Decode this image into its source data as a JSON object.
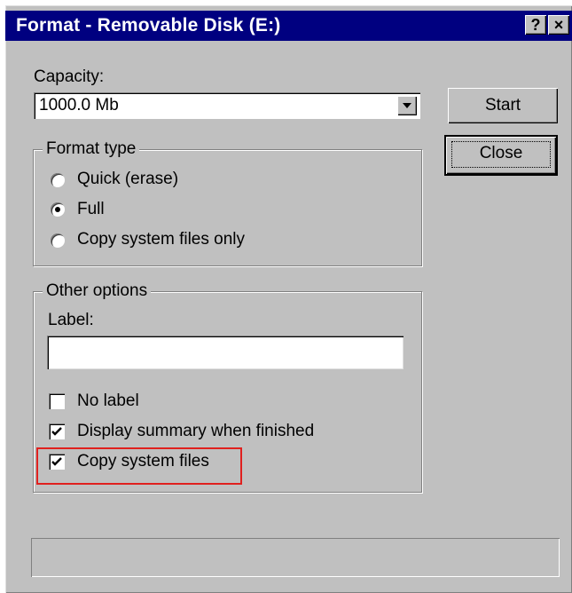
{
  "window": {
    "title": "Format - Removable Disk (E:)",
    "help_label": "?",
    "close_label": "×"
  },
  "capacity": {
    "label": "Capacity:",
    "value": "1000.0 Mb"
  },
  "buttons": {
    "start": "Start",
    "close": "Close"
  },
  "format_type": {
    "label": "Format type",
    "options": [
      {
        "label": "Quick (erase)",
        "selected": false
      },
      {
        "label": "Full",
        "selected": true
      },
      {
        "label": "Copy system files only",
        "selected": false
      }
    ]
  },
  "other_options": {
    "label": "Other options",
    "label_field": {
      "caption": "Label:",
      "value": ""
    },
    "checkboxes": [
      {
        "label": "No label",
        "checked": false
      },
      {
        "label": "Display summary when finished",
        "checked": true
      },
      {
        "label": "Copy system files",
        "checked": true,
        "highlighted": true
      }
    ]
  },
  "colors": {
    "titlebar": "#000080",
    "dialog": "#c0c0c0",
    "highlight": "#e0201e"
  }
}
